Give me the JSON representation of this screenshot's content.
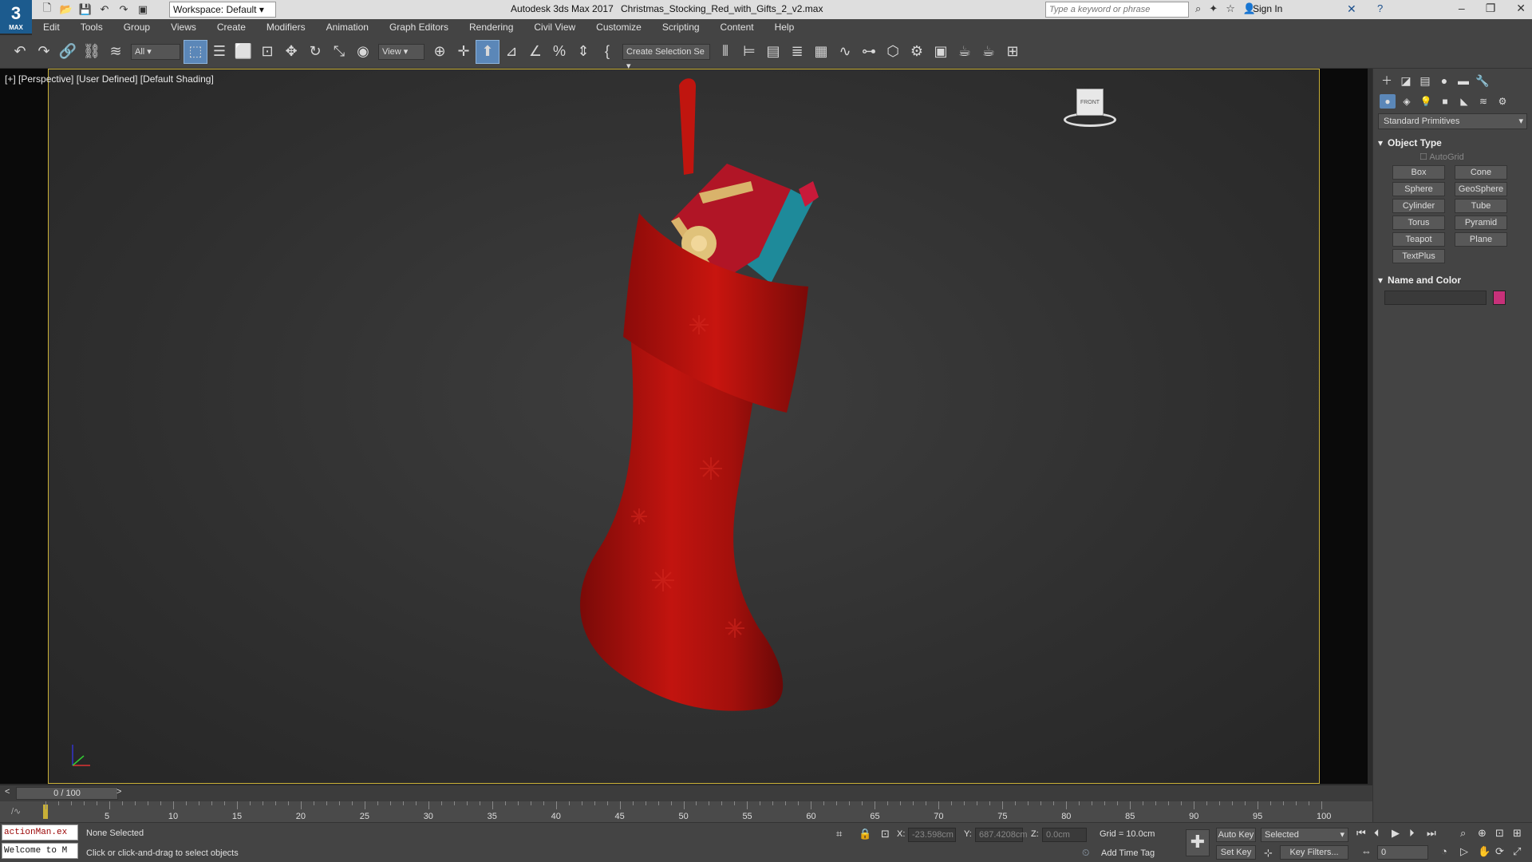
{
  "app": {
    "logo": "3",
    "logo_sub": "MAX",
    "title": "Autodesk 3ds Max 2017",
    "file": "Christmas_Stocking_Red_with_Gifts_2_v2.max",
    "workspace": "Workspace: Default",
    "search_placeholder": "Type a keyword or phrase",
    "sign_in": "Sign In"
  },
  "menu": [
    "Edit",
    "Tools",
    "Group",
    "Views",
    "Create",
    "Modifiers",
    "Animation",
    "Graph Editors",
    "Rendering",
    "Civil View",
    "Customize",
    "Scripting",
    "Content",
    "Help"
  ],
  "toolbar": {
    "filter": "All",
    "ref_coord": "View",
    "selection_set": "Create Selection Se"
  },
  "viewport": {
    "label": "[+] [Perspective] [User Defined] [Default Shading]",
    "viewcube_face": "FRONT"
  },
  "command_panel": {
    "category": "Standard Primitives",
    "object_type_title": "Object Type",
    "autogrid": "AutoGrid",
    "primitives": [
      "Box",
      "Cone",
      "Sphere",
      "GeoSphere",
      "Cylinder",
      "Tube",
      "Torus",
      "Pyramid",
      "Teapot",
      "Plane",
      "TextPlus"
    ],
    "name_color_title": "Name and Color",
    "swatch_color": "#c8317a"
  },
  "timeline": {
    "slider": "0 / 100",
    "prev": "<",
    "next": ">",
    "ticks": [
      "5",
      "10",
      "15",
      "20",
      "25",
      "30",
      "35",
      "40",
      "45",
      "50",
      "55",
      "60",
      "65",
      "70",
      "75",
      "80",
      "85",
      "90",
      "95",
      "100"
    ]
  },
  "status": {
    "maxscript_line1": "actionMan.ex",
    "maxscript_line2": "Welcome to M",
    "selection": "None Selected",
    "prompt": "Click or click-and-drag to select objects",
    "x_label": "X:",
    "x_value": "-23.598cm",
    "y_label": "Y:",
    "y_value": "687.4208cm",
    "z_label": "Z:",
    "z_value": "0.0cm",
    "grid": "Grid = 10.0cm",
    "add_time_tag": "Add Time Tag",
    "auto_key": "Auto Key",
    "set_key": "Set Key",
    "key_mode": "Selected",
    "key_filters": "Key Filters...",
    "frame": "0"
  },
  "colors": {
    "stocking": "#b3100f",
    "viewport_border": "#c9b037",
    "selected_tool": "#5b87b8"
  }
}
